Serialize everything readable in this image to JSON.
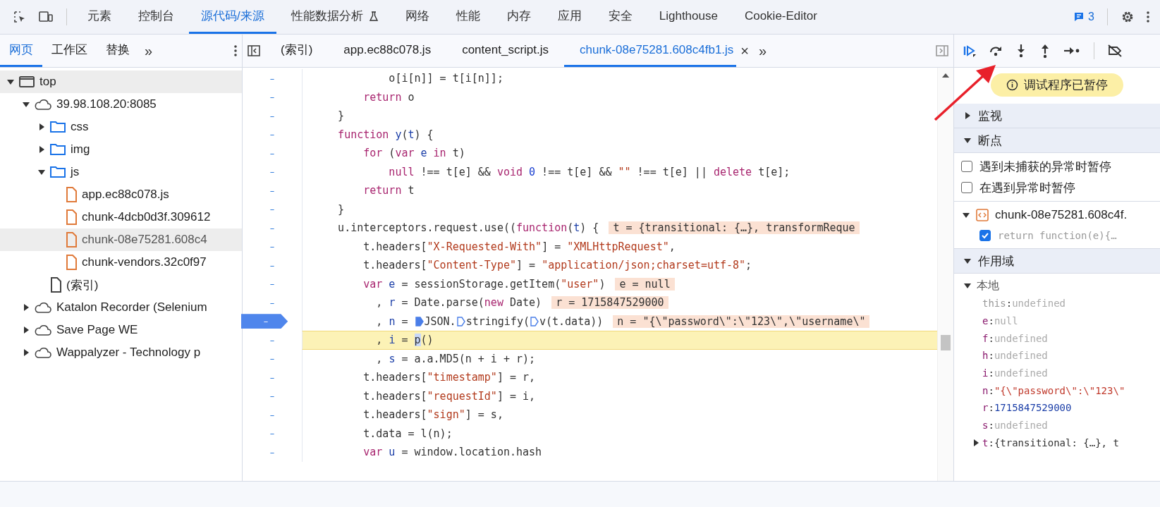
{
  "main_tabs": [
    {
      "label": "元素",
      "selected": false
    },
    {
      "label": "控制台",
      "selected": false
    },
    {
      "label": "源代码/来源",
      "selected": true
    },
    {
      "label": "性能数据分析",
      "selected": false,
      "flask": true
    },
    {
      "label": "网络",
      "selected": false
    },
    {
      "label": "性能",
      "selected": false
    },
    {
      "label": "内存",
      "selected": false
    },
    {
      "label": "应用",
      "selected": false
    },
    {
      "label": "安全",
      "selected": false
    },
    {
      "label": "Lighthouse",
      "selected": false
    },
    {
      "label": "Cookie-Editor",
      "selected": false
    }
  ],
  "issues_count": "3",
  "navigator_tabs": [
    {
      "label": "网页",
      "selected": true
    },
    {
      "label": "工作区",
      "selected": false
    },
    {
      "label": "替换",
      "selected": false
    }
  ],
  "navigator_more": "»",
  "file_tabs": [
    {
      "label": "(索引)",
      "selected": false
    },
    {
      "label": "app.ec88c078.js",
      "selected": false
    },
    {
      "label": "content_script.js",
      "selected": false
    },
    {
      "label": "chunk-08e75281.608c4fb1.js",
      "selected": true
    }
  ],
  "file_tabs_close": "×",
  "file_tabs_more": "»",
  "tree": [
    {
      "label": "top",
      "kind": "frame",
      "expanded": true,
      "selected": true,
      "children": [
        {
          "label": "39.98.108.20:8085",
          "kind": "origin",
          "expanded": true,
          "selected": false,
          "children": [
            {
              "label": "css",
              "kind": "folder",
              "expanded": false,
              "selected": false
            },
            {
              "label": "img",
              "kind": "folder",
              "expanded": false,
              "selected": false
            },
            {
              "label": "js",
              "kind": "folder",
              "expanded": true,
              "selected": false,
              "children": [
                {
                  "label": "app.ec88c078.js",
                  "kind": "script",
                  "selected": false
                },
                {
                  "label": "chunk-4dcb0d3f.309612",
                  "kind": "script",
                  "selected": false
                },
                {
                  "label": "chunk-08e75281.608c4",
                  "kind": "script",
                  "selected": true
                },
                {
                  "label": "chunk-vendors.32c0f97",
                  "kind": "script",
                  "selected": false
                }
              ]
            },
            {
              "label": "(索引)",
              "kind": "page",
              "selected": false
            }
          ]
        },
        {
          "label": "Katalon Recorder (Selenium",
          "kind": "origin",
          "expanded": false,
          "selected": false
        },
        {
          "label": "Save Page WE",
          "kind": "origin",
          "expanded": false,
          "selected": false
        },
        {
          "label": "Wappalyzer - Technology p",
          "kind": "origin",
          "expanded": false,
          "selected": false
        }
      ]
    }
  ],
  "code_lines": [
    {
      "gutter": "–",
      "breakpoint": false,
      "paused": false,
      "tokens": [
        {
          "kind": "plain",
          "text": "            o[i[n]] = t[i[n]];"
        }
      ]
    },
    {
      "gutter": "–",
      "breakpoint": false,
      "paused": false,
      "tokens": [
        {
          "kind": "keyword",
          "text": "        return"
        },
        {
          "kind": "plain",
          "text": " o"
        }
      ]
    },
    {
      "gutter": "–",
      "breakpoint": false,
      "paused": false,
      "tokens": [
        {
          "kind": "plain",
          "text": "    }"
        }
      ]
    },
    {
      "gutter": "–",
      "breakpoint": false,
      "paused": false,
      "tokens": [
        {
          "kind": "keyword",
          "text": "    function"
        },
        {
          "kind": "name",
          "text": " y"
        },
        {
          "kind": "plain",
          "text": "("
        },
        {
          "kind": "name",
          "text": "t"
        },
        {
          "kind": "plain",
          "text": ") {"
        }
      ]
    },
    {
      "gutter": "–",
      "breakpoint": false,
      "paused": false,
      "tokens": [
        {
          "kind": "keyword",
          "text": "        for"
        },
        {
          "kind": "plain",
          "text": " ("
        },
        {
          "kind": "keyword",
          "text": "var"
        },
        {
          "kind": "name",
          "text": " e"
        },
        {
          "kind": "keyword",
          "text": " in"
        },
        {
          "kind": "plain",
          "text": " t)"
        }
      ]
    },
    {
      "gutter": "–",
      "breakpoint": false,
      "paused": false,
      "tokens": [
        {
          "kind": "keyword",
          "text": "            null"
        },
        {
          "kind": "plain",
          "text": " !== t[e] && "
        },
        {
          "kind": "keyword",
          "text": "void"
        },
        {
          "kind": "number",
          "text": " 0"
        },
        {
          "kind": "plain",
          "text": " !== t[e] && "
        },
        {
          "kind": "string",
          "text": "\"\""
        },
        {
          "kind": "plain",
          "text": " !== t[e] || "
        },
        {
          "kind": "keyword",
          "text": "delete"
        },
        {
          "kind": "plain",
          "text": " t[e];"
        }
      ]
    },
    {
      "gutter": "–",
      "breakpoint": false,
      "paused": false,
      "tokens": [
        {
          "kind": "keyword",
          "text": "        return"
        },
        {
          "kind": "plain",
          "text": " t"
        }
      ]
    },
    {
      "gutter": "–",
      "breakpoint": false,
      "paused": false,
      "tokens": [
        {
          "kind": "plain",
          "text": "    }"
        }
      ]
    },
    {
      "gutter": "–",
      "breakpoint": false,
      "paused": false,
      "tokens": [
        {
          "kind": "plain",
          "text": "    u.interceptors.request.use(("
        },
        {
          "kind": "keyword",
          "text": "function"
        },
        {
          "kind": "plain",
          "text": "("
        },
        {
          "kind": "name",
          "text": "t"
        },
        {
          "kind": "plain",
          "text": ") {"
        }
      ],
      "inline_value": "t = {transitional: {…}, transformReque"
    },
    {
      "gutter": "–",
      "breakpoint": false,
      "paused": false,
      "tokens": [
        {
          "kind": "plain",
          "text": "        t.headers["
        },
        {
          "kind": "string",
          "text": "\"X-Requested-With\""
        },
        {
          "kind": "plain",
          "text": "] = "
        },
        {
          "kind": "string",
          "text": "\"XMLHttpRequest\""
        },
        {
          "kind": "plain",
          "text": ","
        }
      ]
    },
    {
      "gutter": "–",
      "breakpoint": false,
      "paused": false,
      "tokens": [
        {
          "kind": "plain",
          "text": "        t.headers["
        },
        {
          "kind": "string",
          "text": "\"Content-Type\""
        },
        {
          "kind": "plain",
          "text": "] = "
        },
        {
          "kind": "string",
          "text": "\"application/json;charset=utf-8\""
        },
        {
          "kind": "plain",
          "text": ";"
        }
      ]
    },
    {
      "gutter": "–",
      "breakpoint": false,
      "paused": false,
      "tokens": [
        {
          "kind": "keyword",
          "text": "        var"
        },
        {
          "kind": "name",
          "text": " e"
        },
        {
          "kind": "plain",
          "text": " = sessionStorage.getItem("
        },
        {
          "kind": "string",
          "text": "\"user\""
        },
        {
          "kind": "plain",
          "text": ")"
        }
      ],
      "inline_value": "e = null"
    },
    {
      "gutter": "–",
      "breakpoint": false,
      "paused": false,
      "tokens": [
        {
          "kind": "plain",
          "text": "          , "
        },
        {
          "kind": "name",
          "text": "r"
        },
        {
          "kind": "plain",
          "text": " = Date.parse("
        },
        {
          "kind": "keyword",
          "text": "new"
        },
        {
          "kind": "plain",
          "text": " Date)"
        }
      ],
      "inline_value": "r = 1715847529000"
    },
    {
      "gutter": "–",
      "breakpoint": true,
      "paused": false,
      "tokens": [
        {
          "kind": "plain",
          "text": "          , "
        },
        {
          "kind": "name",
          "text": "n"
        },
        {
          "kind": "plain",
          "text": " = "
        },
        {
          "kind": "step_filled"
        },
        {
          "kind": "plain",
          "text": "JSON."
        },
        {
          "kind": "step_outline"
        },
        {
          "kind": "plain",
          "text": "stringify("
        },
        {
          "kind": "step_outline"
        },
        {
          "kind": "plain",
          "text": "v(t.data))"
        }
      ],
      "inline_value": "n = \"{\\\"password\\\":\\\"123\\\",\\\"username\\\""
    },
    {
      "gutter": "–",
      "breakpoint": false,
      "paused": true,
      "tokens": [
        {
          "kind": "plain",
          "text": "          , "
        },
        {
          "kind": "name",
          "text": "i"
        },
        {
          "kind": "plain",
          "text": " = "
        },
        {
          "kind": "selected",
          "text": "p"
        },
        {
          "kind": "plain",
          "text": "()"
        }
      ]
    },
    {
      "gutter": "–",
      "breakpoint": false,
      "paused": false,
      "tokens": [
        {
          "kind": "plain",
          "text": "          , "
        },
        {
          "kind": "name",
          "text": "s"
        },
        {
          "kind": "plain",
          "text": " = a.a.MD5(n + i + r);"
        }
      ]
    },
    {
      "gutter": "–",
      "breakpoint": false,
      "paused": false,
      "tokens": [
        {
          "kind": "plain",
          "text": "        t.headers["
        },
        {
          "kind": "string",
          "text": "\"timestamp\""
        },
        {
          "kind": "plain",
          "text": "] = r,"
        }
      ]
    },
    {
      "gutter": "–",
      "breakpoint": false,
      "paused": false,
      "tokens": [
        {
          "kind": "plain",
          "text": "        t.headers["
        },
        {
          "kind": "string",
          "text": "\"requestId\""
        },
        {
          "kind": "plain",
          "text": "] = i,"
        }
      ]
    },
    {
      "gutter": "–",
      "breakpoint": false,
      "paused": false,
      "tokens": [
        {
          "kind": "plain",
          "text": "        t.headers["
        },
        {
          "kind": "string",
          "text": "\"sign\""
        },
        {
          "kind": "plain",
          "text": "] = s,"
        }
      ]
    },
    {
      "gutter": "–",
      "breakpoint": false,
      "paused": false,
      "tokens": [
        {
          "kind": "plain",
          "text": "        t.data = l(n);"
        }
      ]
    },
    {
      "gutter": "–",
      "breakpoint": false,
      "paused": false,
      "tokens": [
        {
          "kind": "keyword",
          "text": "        var"
        },
        {
          "kind": "name",
          "text": " u"
        },
        {
          "kind": "plain",
          "text": " = window.location.hash"
        }
      ]
    }
  ],
  "paused_banner": "调试程序已暂停",
  "sections": [
    {
      "kind": "watch",
      "title": "监视",
      "expanded": false
    },
    {
      "kind": "breakpoints",
      "title": "断点",
      "expanded": true,
      "options": [
        {
          "label": "遇到未捕获的异常时暂停",
          "checked": false
        },
        {
          "label": "在遇到异常时暂停",
          "checked": false
        }
      ],
      "files": [
        {
          "name": "chunk-08e75281.608c4f.",
          "expanded": true,
          "breakpoints": [
            {
              "code": "return function(e){…",
              "checked": true
            }
          ]
        }
      ]
    },
    {
      "kind": "scope",
      "title": "作用域",
      "expanded": true,
      "scopes": [
        {
          "title": "本地",
          "expanded": true,
          "vars": [
            {
              "name": "this",
              "sep": ":",
              "value": "undefined",
              "kind": "undefined"
            },
            {
              "name": "e",
              "sep": ":",
              "value": "null",
              "kind": "null"
            },
            {
              "name": "f",
              "sep": ":",
              "value": "undefined",
              "kind": "undefined"
            },
            {
              "name": "h",
              "sep": ":",
              "value": "undefined",
              "kind": "undefined"
            },
            {
              "name": "i",
              "sep": ":",
              "value": "undefined",
              "kind": "undefined"
            },
            {
              "name": "n",
              "sep": ":",
              "value": "\"{\\\"password\\\":\\\"123\\\"",
              "kind": "string"
            },
            {
              "name": "r",
              "sep": ":",
              "value": "1715847529000",
              "kind": "number"
            },
            {
              "name": "s",
              "sep": ":",
              "value": "undefined",
              "kind": "undefined"
            },
            {
              "name": "t",
              "sep": ":",
              "value": "{transitional: {…}, t",
              "kind": "object",
              "expanded": false
            }
          ]
        }
      ]
    }
  ]
}
